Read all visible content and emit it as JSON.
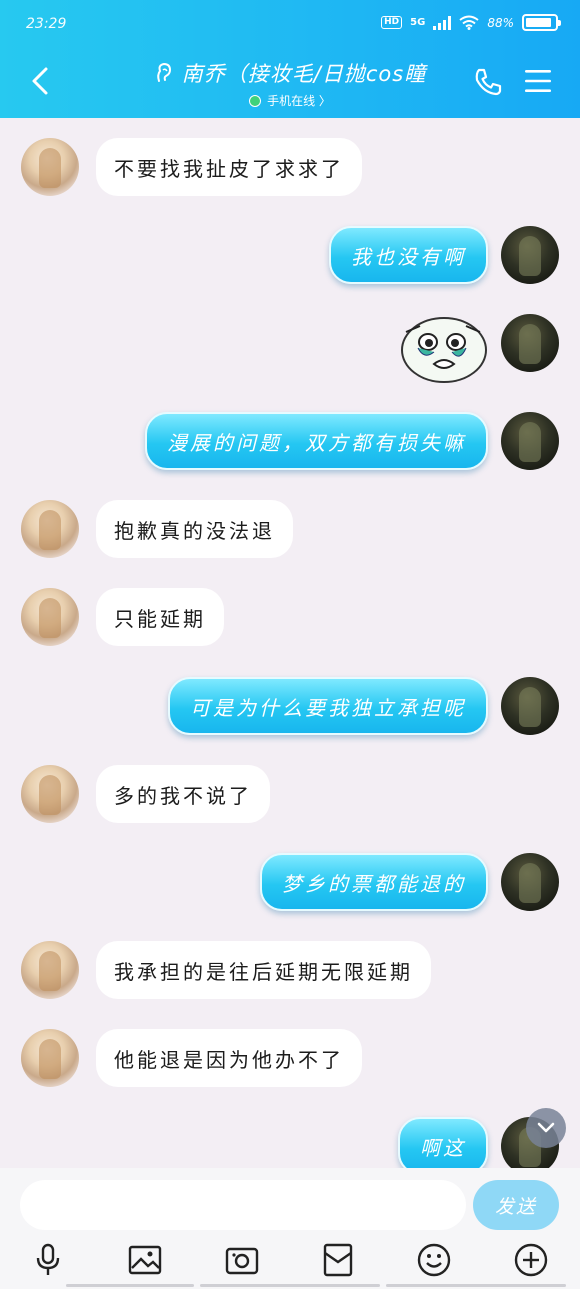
{
  "status": {
    "time": "23:29",
    "hd": "HD",
    "network": "5G",
    "battery_text": "88%",
    "battery_level": 0.88
  },
  "header": {
    "title": "南乔（接妆毛/日抛cos瞳",
    "subtitle": "手机在线 〉"
  },
  "messages": [
    {
      "side": "them",
      "text": "不要找我扯皮了求求了"
    },
    {
      "side": "me",
      "text": "我也没有啊"
    },
    {
      "side": "me",
      "type": "sticker"
    },
    {
      "side": "me",
      "text": "漫展的问题，双方都有损失嘛"
    },
    {
      "side": "them",
      "text": "抱歉真的没法退"
    },
    {
      "side": "them",
      "text": "只能延期"
    },
    {
      "side": "me",
      "text": "可是为什么要我独立承担呢"
    },
    {
      "side": "them",
      "text": "多的我不说了"
    },
    {
      "side": "me",
      "text": "梦乡的票都能退的"
    },
    {
      "side": "them",
      "text": "我承担的是往后延期无限延期"
    },
    {
      "side": "them",
      "text": "他能退是因为他办不了"
    },
    {
      "side": "me",
      "text": "啊这"
    }
  ],
  "input": {
    "value": "",
    "placeholder": "",
    "send_label": "发送"
  },
  "toolbar": [
    "voice-icon",
    "image-icon",
    "camera-icon",
    "red-packet-icon",
    "emoji-icon",
    "plus-icon"
  ],
  "colors": {
    "header": "#1fb8f3",
    "my_bubble": "#25c7f2",
    "their_bubble": "#ffffff",
    "background": "#f3eef4"
  }
}
